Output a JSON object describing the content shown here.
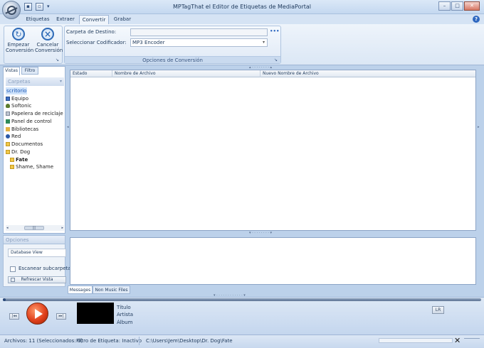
{
  "window": {
    "title": "MPTagThat el Editor de Etiquetas de MediaPortal"
  },
  "ribbon_tabs": [
    "Etiquetas",
    "Extraer",
    "Convertir",
    "Grabar"
  ],
  "ribbon": {
    "start_label": "Empezar Conversión",
    "cancel_label": "Cancelar Conversión",
    "dest_label": "Carpeta de Destino:",
    "dest_value": "",
    "dots": "•••",
    "encoder_label": "Seleccionar Codificador:",
    "encoder_value": "MP3 Encoder",
    "group_label": "Opciones de Conversión"
  },
  "left_tabs": [
    "Vistas",
    "Filtro"
  ],
  "tree": {
    "header": "Carpetas",
    "items": [
      {
        "label": "scritorio",
        "icon": "desktop-icon",
        "selected": true
      },
      {
        "label": "Equipo",
        "icon": "computer-icon"
      },
      {
        "label": "Softonic",
        "icon": "user-icon"
      },
      {
        "label": "Papelera de reciclaje",
        "icon": "recycle-bin-icon"
      },
      {
        "label": "Panel de control",
        "icon": "control-panel-icon"
      },
      {
        "label": "Bibliotecas",
        "icon": "library-icon"
      },
      {
        "label": "Red",
        "icon": "network-icon"
      },
      {
        "label": "Documentos",
        "icon": "folder-icon"
      },
      {
        "label": "Dr. Dog",
        "icon": "folder-icon"
      },
      {
        "label": "Fate",
        "icon": "folder-icon"
      },
      {
        "label": "Shame, Shame",
        "icon": "folder-icon"
      }
    ]
  },
  "options": {
    "header": "Opciones",
    "view_value": "Database View",
    "scan_label": "Escanear subcarpeta",
    "refresh_label": "Refrescar Vista"
  },
  "file_list": {
    "columns": [
      "Estado",
      "Nombre de Archivo",
      "Nuevo Nombre de Archivo"
    ]
  },
  "message_tabs": [
    "Messages",
    "Non Music Files"
  ],
  "player": {
    "progress": 0.005,
    "title_label": "Título",
    "artist_label": "Artista",
    "album_label": "Álbum",
    "lr_label": "LR"
  },
  "status": {
    "files": "Archivos: 11 (Seleccionados: 0)",
    "filter": "Filtro de Etiqueta: Inactivo",
    "path": "C:\\Users\\Jem\\Desktop\\Dr. Dog\\Fate",
    "close_glyph": "✕"
  }
}
